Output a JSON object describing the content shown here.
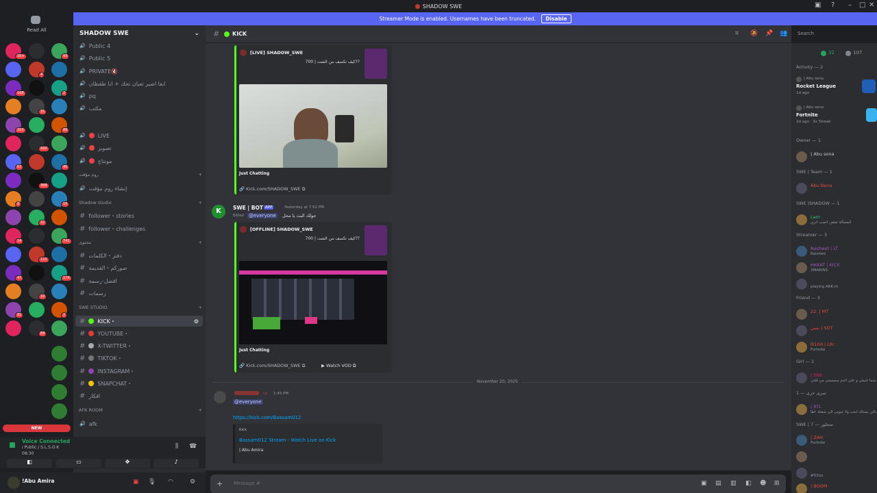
{
  "window": {
    "title": "SHADOW SWE"
  },
  "streamer_banner": {
    "text": "Streamer Mode is enabled. Usernames have been truncated.",
    "button": "Disable"
  },
  "guilds": {
    "read_all": "Read All",
    "new_badge": "NEW",
    "badges": [
      "1K+",
      "93",
      "4",
      "168",
      "2",
      "31",
      "203",
      "88",
      "420",
      "67",
      "45",
      "388",
      "8",
      "10",
      "22",
      "14",
      "741",
      "133",
      "47",
      "179",
      "10",
      "81",
      "2",
      "64",
      "16",
      "411",
      "82",
      "11"
    ]
  },
  "server": {
    "name": "SHADOW SWE"
  },
  "channels": [
    {
      "label": "Public 4",
      "type": "voice"
    },
    {
      "label": "Public 5",
      "type": "voice"
    },
    {
      "label": "PRIVATE🔇",
      "type": "voice"
    },
    {
      "label": "ابغا اصير تعبان تحك + انا طقطان",
      "type": "voice"
    },
    {
      "label": "pq",
      "type": "voice"
    },
    {
      "label": "مكتب",
      "type": "voice"
    },
    {
      "label": "LIVE",
      "type": "voice"
    },
    {
      "label": "تصوير",
      "type": "voice"
    },
    {
      "label": "مونتاج",
      "type": "voice"
    },
    {
      "label": "إنشاء روم مؤقت",
      "type": "voice"
    },
    {
      "label": "follower・stories",
      "type": "text"
    },
    {
      "label": "follower・challenges",
      "type": "text"
    },
    {
      "label": "دفتر・الكلمات",
      "type": "text"
    },
    {
      "label": "صوركم・القديمة",
      "type": "text"
    },
    {
      "label": "افضل-رسمة",
      "type": "text"
    },
    {
      "label": "رسمات",
      "type": "text"
    },
    {
      "label": "KICK・",
      "type": "text"
    },
    {
      "label": "YOUTUBE・",
      "type": "text"
    },
    {
      "label": "X-TWITTER・",
      "type": "text"
    },
    {
      "label": "TIKTOK・",
      "type": "text"
    },
    {
      "label": "INSTAGRAM・",
      "type": "text"
    },
    {
      "label": "SNAPCHAT・",
      "type": "text"
    },
    {
      "label": "افكار",
      "type": "text"
    },
    {
      "label": "afk",
      "type": "voice"
    }
  ],
  "categories": [
    "روم مؤقت",
    "Shadow studio",
    "محتوى",
    "SWE STUDIO",
    "AFK ROOM"
  ],
  "voice": {
    "status": "Voice Connected",
    "channel": "ı Public / S.L.S.O.K",
    "time": "08:30"
  },
  "user": {
    "name": "!Abu Amira"
  },
  "chat": {
    "channel": "KICK",
    "embed1": {
      "title": "[LIVE] SHADOW_SWE",
      "desc": "كيف تكسف من الشت | 700??",
      "category": "Just Chatting",
      "link": "Kick.com/SHADOW_SWE"
    },
    "bot": {
      "name": "SWE | BOT",
      "tag": "APP",
      "time": "Yesterday at 7:52 PM",
      "edited": "Edited",
      "mention": "@everyone",
      "text": "جولك البث يا محل"
    },
    "embed2": {
      "title": "[OFFLINE] SHADOW_SWE",
      "desc": "كيف تكسف من الشت | 700??",
      "category": "Just Chatting",
      "link": "Kick.com/SHADOW_SWE",
      "vod": "Watch VOD"
    },
    "divider": "November 20, 2025",
    "msg3": {
      "time": "1:45 PM",
      "mention": "@everyone",
      "link": "https://kick.com/Bassam012",
      "embed_site": "Kick",
      "embed_title": "Bassam012 Stream - Watch Live on Kick",
      "embed_desc": "| Abu Amira"
    },
    "placeholder": "Message #"
  },
  "search": {
    "placeholder": "Search"
  },
  "members": {
    "online": "32",
    "total": "107",
    "activity": "Activity — 2",
    "act1": {
      "game": "Rocket League",
      "sub": "1d ago",
      "user": "| Abu sona"
    },
    "act2": {
      "game": "Fortnite",
      "sub": "2d ago · 3x Streak",
      "user": "| Abu sona"
    },
    "groups": [
      {
        "h": "Owner — 1",
        "items": [
          {
            "n": "| Abu sona",
            "s": "",
            "c": "#c9cdd4"
          }
        ]
      },
      {
        "h": "SWE | Team — 1",
        "items": [
          {
            "n": "Abu Bena",
            "s": "",
            "c": "#e74c3c"
          }
        ]
      },
      {
        "h": "SWE |SHADOW — 1",
        "items": [
          {
            "n": "Lam",
            "s": "المسألة تعتقن اتصب انزي",
            "c": "#2ecc71"
          }
        ]
      },
      {
        "h": "Streamer — 3",
        "items": [
          {
            "n": "Nasheet | LT",
            "s": "Raished",
            "c": "#9b59b6"
          },
          {
            "n": "HKKAT | KICK",
            "s": "3MARINS",
            "c": "#9b59b6"
          },
          {
            "n": "",
            "s": "playing ARK:m",
            "c": "#9b59b6"
          }
        ]
      },
      {
        "h": "Friend — 3",
        "items": [
          {
            "n": "22. | MT",
            "s": "",
            "c": "#e74c3c"
          },
          {
            "n": "نسي | SOT",
            "s": "",
            "c": "#e74c3c"
          },
          {
            "n": "lll10d | LRr",
            "s": "Fortnite",
            "c": "#e74c3c"
          }
        ]
      },
      {
        "h": "Girl — 1",
        "items": [
          {
            "n": "| 506",
            "s": "شما غنيفي و علي الدم سمسمي من قلتي",
            "c": "#e91e63"
          }
        ]
      },
      {
        "h": "سرى حرى — 1",
        "items": [
          {
            "n": "| RTL",
            "s": "بالي بشتاك انعب ولا عيوني الي شفتك اطا",
            "c": "#9b59b6"
          }
        ]
      },
      {
        "h": "SWE | 7 — متحلور",
        "items": [
          {
            "n": "| ZAH",
            "s": "Fortnite",
            "c": "#e74c3c"
          },
          {
            "n": "",
            "s": "",
            "c": "#e74c3c"
          },
          {
            "n": "",
            "s": "#53oo",
            "c": "#e74c3c"
          },
          {
            "n": "| BOOM",
            "s": "",
            "c": "#e74c3c"
          }
        ]
      }
    ]
  }
}
